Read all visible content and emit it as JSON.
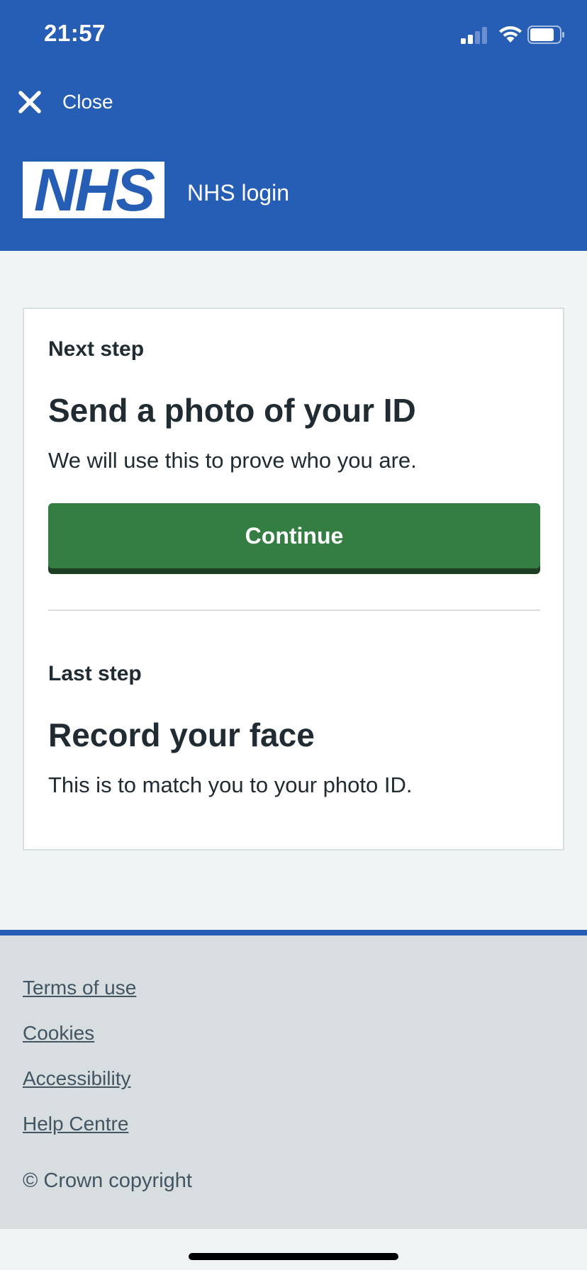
{
  "status_bar": {
    "time": "21:57"
  },
  "header": {
    "close_label": "Close",
    "logo_text": "NHS",
    "service_name": "NHS login",
    "background_color": "#275eb5"
  },
  "card": {
    "next_step": {
      "caption": "Next step",
      "heading": "Send a photo of your ID",
      "body": "We will use this to prove who you are.",
      "button_label": "Continue"
    },
    "last_step": {
      "caption": "Last step",
      "heading": "Record your face",
      "body": "This is to match you to your photo ID."
    }
  },
  "footer": {
    "links": [
      "Terms of use",
      "Cookies",
      "Accessibility",
      "Help Centre"
    ],
    "copyright": "© Crown copyright"
  },
  "colors": {
    "brand_blue": "#275eb5",
    "button_green": "#347d43",
    "page_background": "#f0f4f5",
    "footer_background": "#d8dde0"
  },
  "icons": {
    "close": "close-icon",
    "signal": "signal-icon",
    "wifi": "wifi-icon",
    "battery": "battery-icon"
  }
}
